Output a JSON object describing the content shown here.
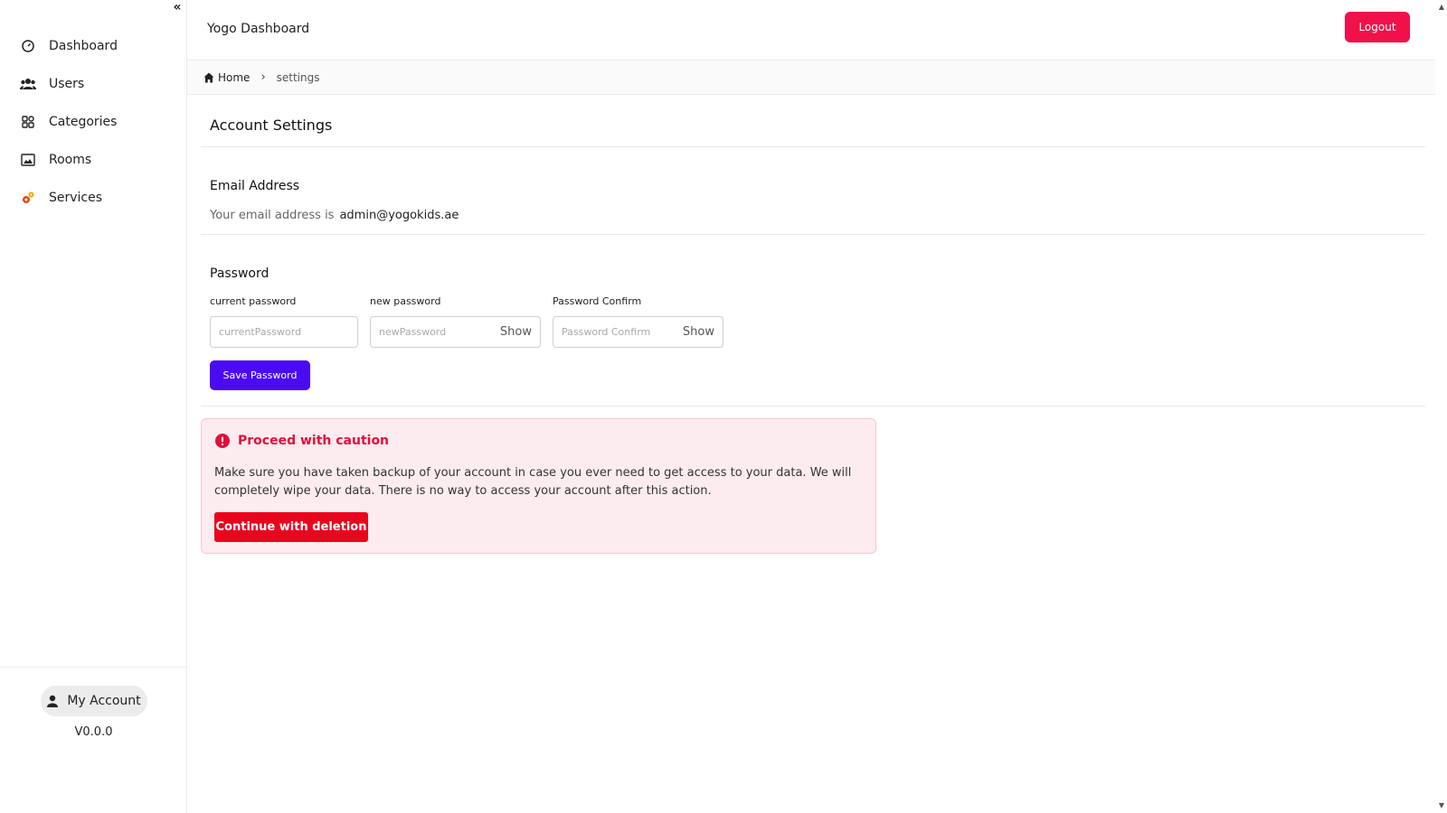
{
  "sidebar": {
    "collapse_label": "«",
    "items": [
      {
        "label": "Dashboard",
        "icon": "gauge-icon"
      },
      {
        "label": "Users",
        "icon": "users-icon"
      },
      {
        "label": "Categories",
        "icon": "grid-icon"
      },
      {
        "label": "Rooms",
        "icon": "image-icon"
      },
      {
        "label": "Services",
        "icon": "gears-icon"
      }
    ],
    "account_label": "My Account",
    "version": "V0.0.0"
  },
  "header": {
    "title": "Yogo Dashboard",
    "logout_label": "Logout",
    "logout_color": "#f0104a"
  },
  "breadcrumb": {
    "home": "Home",
    "separator": "›",
    "current": "settings"
  },
  "main": {
    "page_title": "Account Settings",
    "email": {
      "title": "Email Address",
      "prefix": "Your email address is",
      "value": "admin@yogokids.ae"
    },
    "password": {
      "title": "Password",
      "current_label": "current password",
      "current_placeholder": "currentPassword",
      "new_label": "new password",
      "new_placeholder": "newPassword",
      "confirm_label": "Password Confirm",
      "confirm_placeholder": "Password Confirm",
      "show_label": "Show",
      "save_label": "Save Password",
      "save_color": "#4b0bf0"
    },
    "caution": {
      "title": "Proceed with caution",
      "body": "Make sure you have taken backup of your account in case you ever need to get access to your data. We will completely wipe your data. There is no way to access your account after this action.",
      "button_label": "Continue with deletion",
      "accent_color": "#e8061f"
    }
  }
}
